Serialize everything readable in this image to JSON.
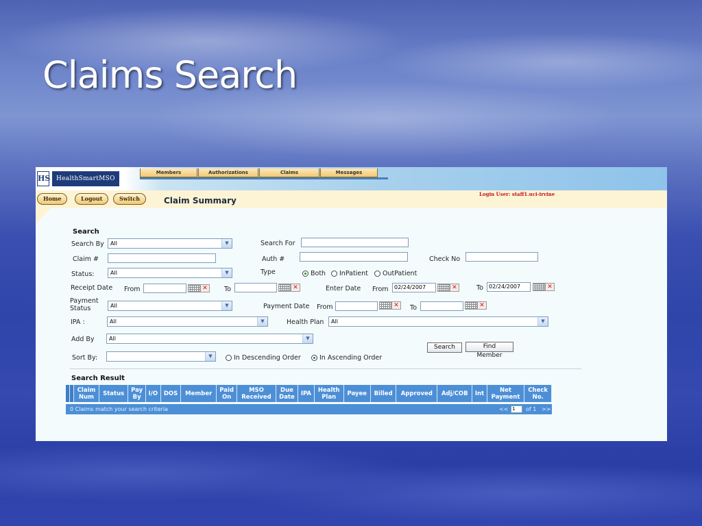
{
  "slide": {
    "title": "Claims Search"
  },
  "app": {
    "logo": {
      "mark": "HS",
      "name": "HealthSmartMSO"
    },
    "tabs": [
      "Members",
      "Authorizations",
      "Claims",
      "Messages"
    ],
    "actions": [
      "Home",
      "Logout",
      "Switch"
    ],
    "page_title": "Claim Summary",
    "login_user": "Login User: staff1.uci-irvine"
  },
  "search": {
    "section_title": "Search",
    "search_by": {
      "label": "Search By",
      "value": "All"
    },
    "search_for": {
      "label": "Search For",
      "value": ""
    },
    "claim_no": {
      "label": "Claim #",
      "value": ""
    },
    "auth_no": {
      "label": "Auth #",
      "value": ""
    },
    "check_no": {
      "label": "Check No",
      "value": ""
    },
    "status": {
      "label": "Status:",
      "value": "All"
    },
    "type": {
      "label": "Type",
      "options": [
        "Both",
        "InPatient",
        "OutPatient"
      ],
      "selected": "Both"
    },
    "receipt_date": {
      "label": "Receipt Date",
      "from_label": "From",
      "to_label": "To",
      "from": "",
      "to": ""
    },
    "enter_date": {
      "label": "Enter Date",
      "from_label": "From",
      "to_label": "To",
      "from": "02/24/2007",
      "to": "02/24/2007"
    },
    "payment_status": {
      "label_line1": "Payment",
      "label_line2": "Status",
      "value": "All"
    },
    "payment_date": {
      "label": "Payment Date",
      "from_label": "From",
      "to_label": "To",
      "from": "",
      "to": ""
    },
    "ipa": {
      "label": "IPA :",
      "value": "All"
    },
    "health_plan": {
      "label": "Health Plan",
      "value": "All"
    },
    "add_by": {
      "label": "Add By",
      "value": "All"
    },
    "sort_by": {
      "label": "Sort By:",
      "value": ""
    },
    "sort_order": {
      "options": [
        "In Descending Order",
        "In Ascending Order"
      ],
      "selected": "In Ascending Order"
    },
    "search_button": "Search",
    "find_member_button": "Find Member"
  },
  "results": {
    "section_title": "Search Result",
    "columns": [
      [
        "Claim",
        "Num"
      ],
      [
        "Status"
      ],
      [
        "Pay",
        "By"
      ],
      [
        "I/O"
      ],
      [
        "DOS"
      ],
      [
        "Member"
      ],
      [
        "Paid",
        "On"
      ],
      [
        "MSO",
        "Received"
      ],
      [
        "Due",
        "Date"
      ],
      [
        "IPA"
      ],
      [
        "Health",
        "Plan"
      ],
      [
        "Payee"
      ],
      [
        "Billed"
      ],
      [
        "Approved"
      ],
      [
        "Adj/COB"
      ],
      [
        "Int"
      ],
      [
        "Net",
        "Payment"
      ],
      [
        "Check",
        "No."
      ]
    ],
    "message": "0 Claims match your search criteria",
    "pager": {
      "prev": "<<",
      "page": "1",
      "of": "of 1",
      "next": ">>"
    }
  }
}
